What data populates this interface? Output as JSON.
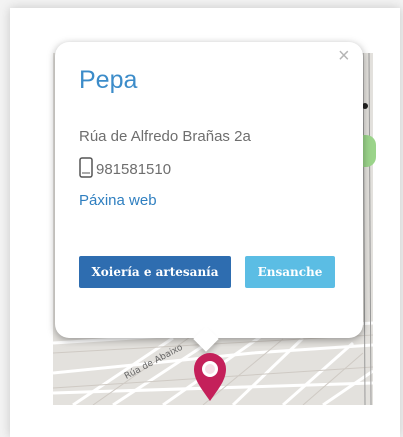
{
  "popup": {
    "title": "Pepa",
    "address": "Rúa de Alfredo Brañas 2a",
    "phone": "981581510",
    "web_link": "Páxina web",
    "close_symbol": "×",
    "tags": [
      {
        "label": "Xoiería e artesanía",
        "color": "#2e6db0"
      },
      {
        "label": "Ensanche",
        "color": "#5bbde4"
      }
    ]
  },
  "map": {
    "street_label": "Rúa de Abaixo",
    "marker_color": "#c4205a"
  },
  "icons": {
    "phone": "mobile-phone-icon",
    "close": "close-icon",
    "marker": "map-pin-icon"
  }
}
